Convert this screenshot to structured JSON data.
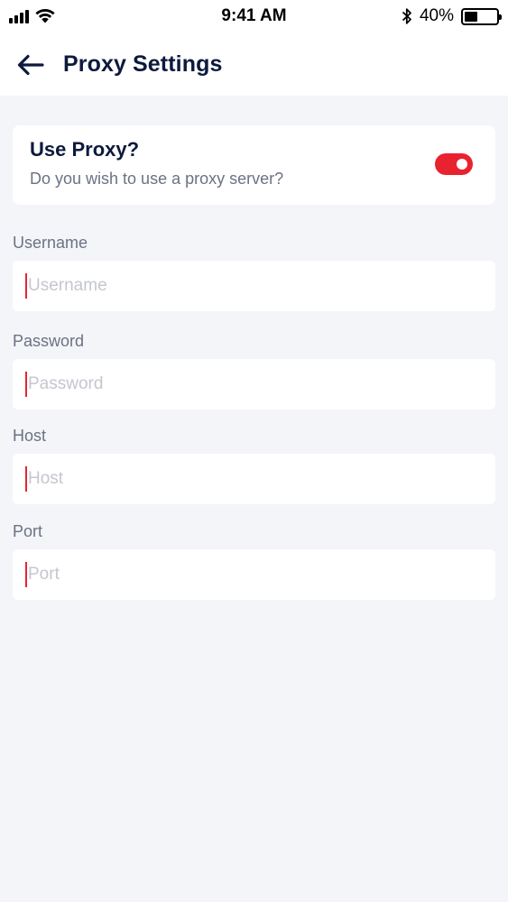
{
  "status_bar": {
    "time": "9:41 AM",
    "battery_percent": "40%",
    "battery_level": 0.4,
    "icons": [
      "signal-icon",
      "wifi-icon",
      "bluetooth-icon",
      "battery-icon"
    ]
  },
  "header": {
    "title": "Proxy Settings",
    "back_icon": "arrow-left-icon"
  },
  "proxy": {
    "title": "Use Proxy?",
    "subtitle": "Do you wish to use a proxy server?",
    "enabled": true
  },
  "fields": {
    "username": {
      "label": "Username",
      "placeholder": "Username",
      "value": ""
    },
    "password": {
      "label": "Password",
      "placeholder": "Password",
      "value": ""
    },
    "host": {
      "label": "Host",
      "placeholder": "Host",
      "value": ""
    },
    "port": {
      "label": "Port",
      "placeholder": "Port",
      "value": ""
    }
  },
  "colors": {
    "accent": "#e8232f",
    "title": "#0d1a3d",
    "background": "#f4f5f9",
    "label": "#6b7283",
    "placeholder": "#c4c7cf"
  }
}
